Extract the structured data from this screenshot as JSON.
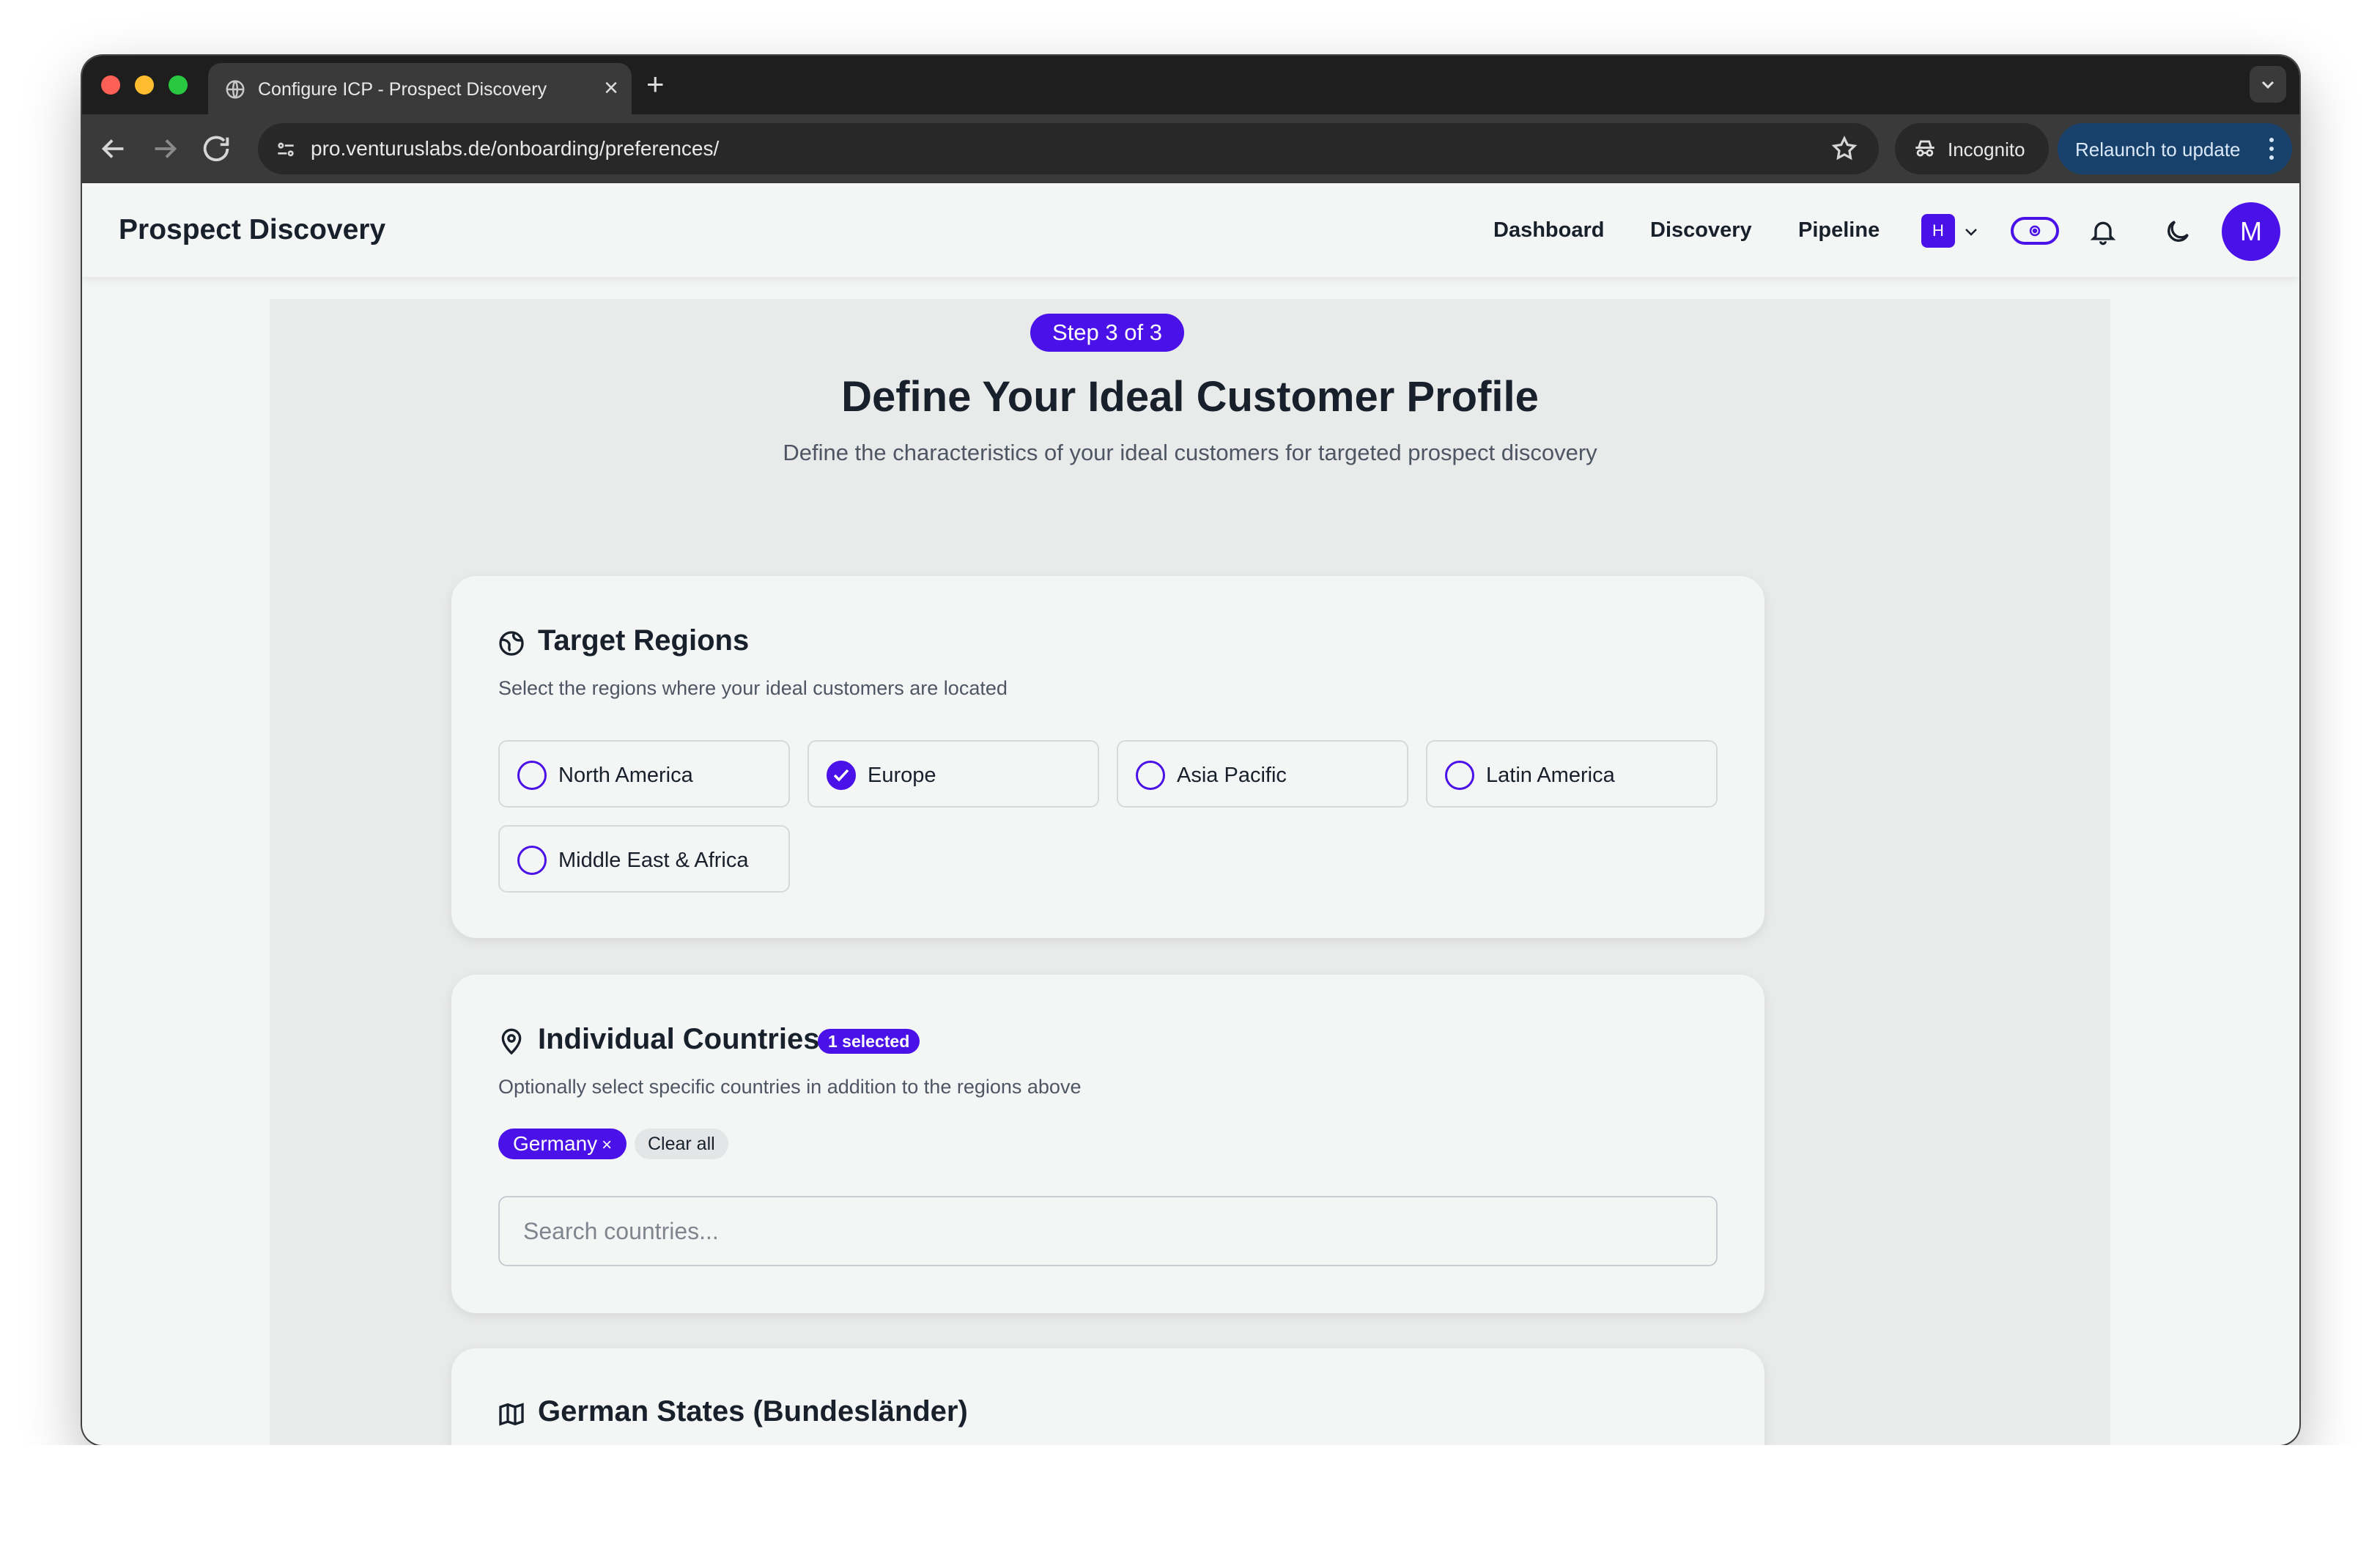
{
  "browser": {
    "tab_title": "Configure ICP - Prospect Discovery",
    "tab_close": "×",
    "new_tab": "+",
    "url": "pro.venturuslabs.de/onboarding/preferences/",
    "incognito_label": "Incognito",
    "relaunch_label": "Relaunch to update"
  },
  "app": {
    "brand": "Prospect Discovery",
    "nav": [
      "Dashboard",
      "Discovery",
      "Pipeline"
    ],
    "workspace_badge": "H",
    "avatar_initial": "M",
    "accent_color": "#4a12e8"
  },
  "page": {
    "step": "Step 3 of 3",
    "title": "Define Your Ideal Customer Profile",
    "subtitle": "Define the characteristics of your ideal customers for targeted prospect discovery"
  },
  "regions_card": {
    "title": "Target Regions",
    "description": "Select the regions where your ideal customers are located",
    "regions": [
      {
        "label": "North America",
        "checked": false
      },
      {
        "label": "Europe",
        "checked": true
      },
      {
        "label": "Asia Pacific",
        "checked": false
      },
      {
        "label": "Latin America",
        "checked": false
      },
      {
        "label": "Middle East & Africa",
        "checked": false
      }
    ]
  },
  "countries_card": {
    "title": "Individual Countries",
    "count_badge": "1 selected",
    "description": "Optionally select specific countries in addition to the regions above",
    "selected": [
      "Germany"
    ],
    "chip_remove": "×",
    "clear_all_label": "Clear all",
    "search_placeholder": "Search countries...",
    "search_value": ""
  },
  "states_card": {
    "title": "German States (Bundesländer)"
  }
}
